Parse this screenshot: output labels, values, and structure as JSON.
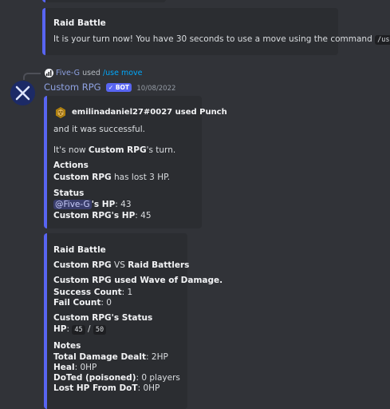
{
  "colors": {
    "background": "#313338",
    "embed_bg": "#2b2d31",
    "embed_accent": "#5865f2",
    "username": "#8ea1e1",
    "link": "#00a8fc"
  },
  "prev_embed": {
    "title": "Raid Battle",
    "text_prefix": "It is your turn now! You have 30 seconds to use a move using the command",
    "command": "/use",
    "text_suffix": "."
  },
  "reply": {
    "avatar_icon": "reply-avatar-icon",
    "user": "Five-G",
    "verb": "used",
    "command": "/use move"
  },
  "message": {
    "author": "Custom RPG",
    "bot_badge": "BOT",
    "timestamp": "10/08/2022",
    "avatar_icon": "x-logo-icon"
  },
  "embed1": {
    "author_icon": "honeycomb-icon",
    "author": "emilinadaniel27#0027 used Punch",
    "desc1": "and it was successful.",
    "desc2_prefix": "It's now",
    "desc2_bold": "Custom RPG",
    "desc2_suffix": "'s turn.",
    "actions_title": "Actions",
    "actions_bold": "Custom RPG",
    "actions_text": "has lost 3 HP.",
    "status_title": "Status",
    "status_mention": "@Five-G",
    "status_line1_bold": "'s HP",
    "status_line1_value": ": 43",
    "status_line2_bold": "Custom RPG's HP",
    "status_line2_value": ": 45"
  },
  "embed2": {
    "title": "Raid Battle",
    "vs_left": "Custom RPG",
    "vs_mid": "VS",
    "vs_right": "Raid Battlers",
    "wave_title": "Custom RPG used Wave of Damage.",
    "success_label": "Success Count",
    "success_value": ": 1",
    "fail_label": "Fail Count",
    "fail_value": ": 0",
    "status_title": "Custom RPG's Status",
    "hp_label": "HP",
    "hp_sep": ":",
    "hp_current": "45",
    "hp_slash": "/",
    "hp_max": "50",
    "notes_title": "Notes",
    "total_label": "Total Damage Dealt",
    "total_value": ": 2HP",
    "heal_label": "Heal",
    "heal_value": ": 0HP",
    "dot_label": "DoTed (poisoned)",
    "dot_value": ": 0 players",
    "lost_label": "Lost HP From DoT",
    "lost_value": ": 0HP"
  }
}
